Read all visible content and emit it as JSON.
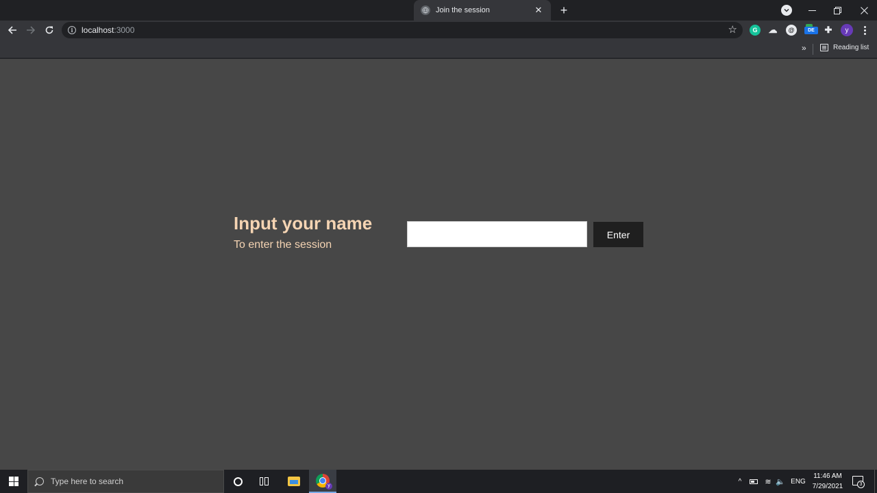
{
  "browser": {
    "tab": {
      "title": "Join the session",
      "close_glyph": "✕"
    },
    "new_tab_glyph": "+",
    "window_controls": [
      "minimize",
      "restore",
      "close"
    ],
    "address": {
      "host": "localhost",
      "port": ":3000",
      "info_glyph": "i"
    },
    "extensions": [
      {
        "name": "grammarly-icon",
        "glyph": "G"
      },
      {
        "name": "cloud-extension-icon",
        "glyph": "☁"
      },
      {
        "name": "circle-extension-icon",
        "glyph": "@"
      },
      {
        "name": "de-extension-icon",
        "glyph": "DE"
      },
      {
        "name": "extensions-puzzle-icon",
        "glyph": "✚"
      }
    ],
    "profile_initial": "y",
    "bookmarks": {
      "more_glyph": "»",
      "reading_list": "Reading list"
    }
  },
  "page": {
    "heading": "Input your name",
    "subheading": "To enter the session",
    "name_input": {
      "value": "",
      "placeholder": ""
    },
    "enter_button": "Enter",
    "colors": {
      "background": "#474747",
      "heading": "#f5d4b3",
      "button": "#1f1f1f"
    }
  },
  "taskbar": {
    "search_placeholder": "Type here to search",
    "chrome_badge": "y",
    "tray": {
      "up_glyph": "^",
      "wifi_glyph": "≋",
      "volume_glyph": "🔈",
      "language": "ENG"
    },
    "clock": {
      "time": "11:46 AM",
      "date": "7/29/2021"
    },
    "notification_count": "3"
  }
}
